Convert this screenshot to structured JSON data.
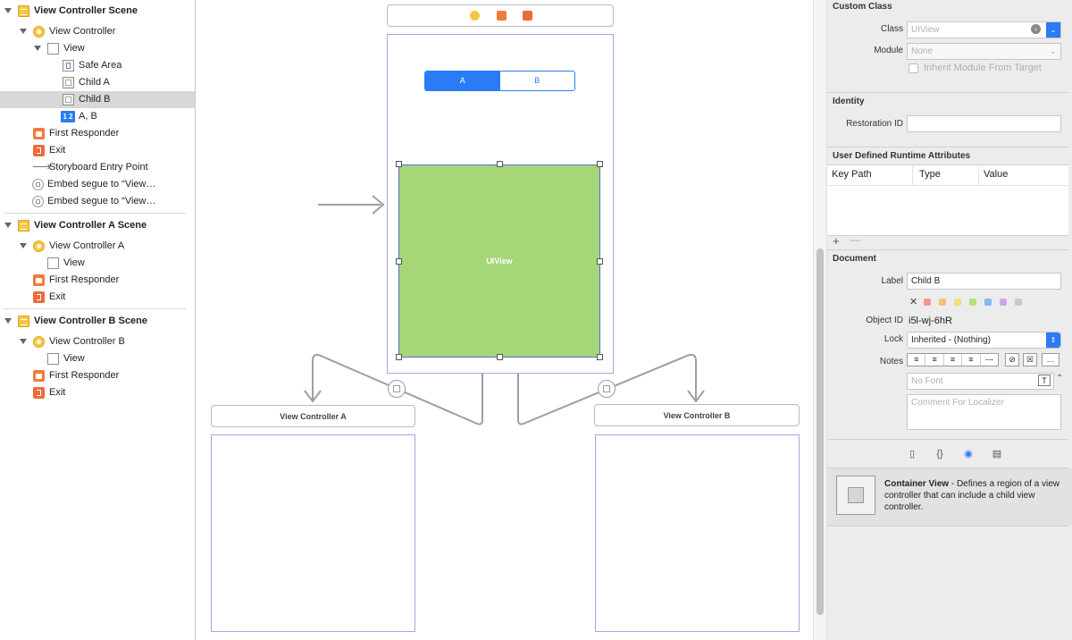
{
  "outline": {
    "rows": [
      {
        "label": "View Controller Scene",
        "icon": "scene-icon"
      },
      {
        "label": "View Controller",
        "icon": "view-controller-icon"
      },
      {
        "label": "View",
        "icon": "view-icon"
      },
      {
        "label": "Safe Area",
        "icon": "safe-area-icon"
      },
      {
        "label": "Child A",
        "icon": "container-view-icon"
      },
      {
        "label": "Child B",
        "icon": "container-view-icon"
      },
      {
        "label": "A, B",
        "icon": "segmented-control-icon",
        "icon_text": "1 2"
      },
      {
        "label": "First Responder",
        "icon": "first-responder-icon"
      },
      {
        "label": "Exit",
        "icon": "exit-icon"
      },
      {
        "label": "Storyboard Entry Point",
        "icon": "entry-arrow-icon",
        "icon_text": "⟶"
      },
      {
        "label": "Embed segue to “View…",
        "icon": "embed-segue-icon"
      },
      {
        "label": "Embed segue to “View…",
        "icon": "embed-segue-icon"
      },
      {
        "label": "View Controller A Scene",
        "icon": "scene-icon"
      },
      {
        "label": "View Controller A",
        "icon": "view-controller-icon"
      },
      {
        "label": "View",
        "icon": "view-icon"
      },
      {
        "label": "First Responder",
        "icon": "first-responder-icon"
      },
      {
        "label": "Exit",
        "icon": "exit-icon"
      },
      {
        "label": "View Controller B Scene",
        "icon": "scene-icon"
      },
      {
        "label": "View Controller B",
        "icon": "view-controller-icon"
      },
      {
        "label": "View",
        "icon": "view-icon"
      },
      {
        "label": "First Responder",
        "icon": "first-responder-icon"
      },
      {
        "label": "Exit",
        "icon": "exit-icon"
      }
    ],
    "selected_label": "Child B"
  },
  "canvas": {
    "segmented": [
      "A",
      "B"
    ],
    "selected_view_label": "UIView",
    "selected_view_color": "#a5d677",
    "scene_a_title": "View Controller A",
    "scene_b_title": "View Controller B"
  },
  "inspector": {
    "custom_class": {
      "header": "Custom Class",
      "class_label": "Class",
      "class_placeholder": "UIView",
      "module_label": "Module",
      "module_placeholder": "None",
      "inherit_label": "Inherit Module From Target"
    },
    "identity": {
      "header": "Identity",
      "restoration_label": "Restoration ID",
      "restoration_value": ""
    },
    "runtime": {
      "header": "User Defined Runtime Attributes",
      "columns": [
        "Key Path",
        "Type",
        "Value"
      ],
      "add": "+",
      "remove": "—"
    },
    "document": {
      "header": "Document",
      "label_label": "Label",
      "label_value": "Child B",
      "clear_mark": "✕",
      "label_colors": [
        "#f19a8a",
        "#f5c27a",
        "#f3df7a",
        "#b8e07e",
        "#86b6f5",
        "#cfa4ec",
        "#c9c9c9"
      ],
      "object_id_label": "Object ID",
      "object_id": "i5l-wj-6hR",
      "lock_label": "Lock",
      "lock_value": "Inherited - (Nothing)",
      "notes_label": "Notes",
      "font_placeholder": "No Font",
      "comment_placeholder": "Comment For Localizer"
    },
    "library": {
      "tabs": [
        "file-icon",
        "code-braces-icon",
        "object-library-icon",
        "media-library-icon"
      ],
      "item_title": "Container View",
      "item_desc": " - Defines a region of a view controller that can include a child view controller."
    }
  }
}
